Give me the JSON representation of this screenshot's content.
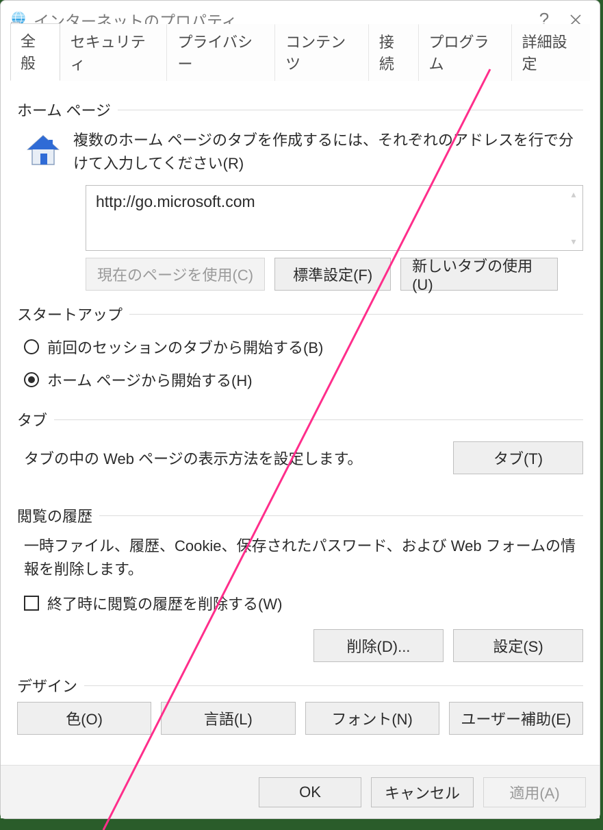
{
  "window": {
    "title": "インターネットのプロパティ",
    "help_tooltip": "?",
    "close_tooltip": "閉じる"
  },
  "tabs": {
    "general": "全般",
    "security": "セキュリティ",
    "privacy": "プライバシー",
    "content": "コンテンツ",
    "connections": "接続",
    "programs": "プログラム",
    "advanced": "詳細設定",
    "active": "general"
  },
  "home_page": {
    "group_label": "ホーム ページ",
    "instruction": "複数のホーム ページのタブを作成するには、それぞれのアドレスを行で分けて入力してください(R)",
    "url_value": "http://go.microsoft.com",
    "use_current": "現在のページを使用(C)",
    "use_default": "標準設定(F)",
    "use_new_tab": "新しいタブの使用(U)"
  },
  "startup": {
    "group_label": "スタートアップ",
    "option_last_session": "前回のセッションのタブから開始する(B)",
    "option_home_page": "ホーム ページから開始する(H)",
    "selected": "home_page"
  },
  "tabs_section": {
    "group_label": "タブ",
    "description": "タブの中の Web ページの表示方法を設定します。",
    "button": "タブ(T)"
  },
  "history": {
    "group_label": "閲覧の履歴",
    "description": "一時ファイル、履歴、Cookie、保存されたパスワード、および Web フォームの情報を削除します。",
    "delete_on_exit": "終了時に閲覧の履歴を削除する(W)",
    "delete_on_exit_checked": false,
    "delete_button": "削除(D)...",
    "settings_button": "設定(S)"
  },
  "design": {
    "group_label": "デザイン",
    "colors": "色(O)",
    "languages": "言語(L)",
    "fonts": "フォント(N)",
    "accessibility": "ユーザー補助(E)"
  },
  "footer": {
    "ok": "OK",
    "cancel": "キャンセル",
    "apply": "適用(A)"
  }
}
